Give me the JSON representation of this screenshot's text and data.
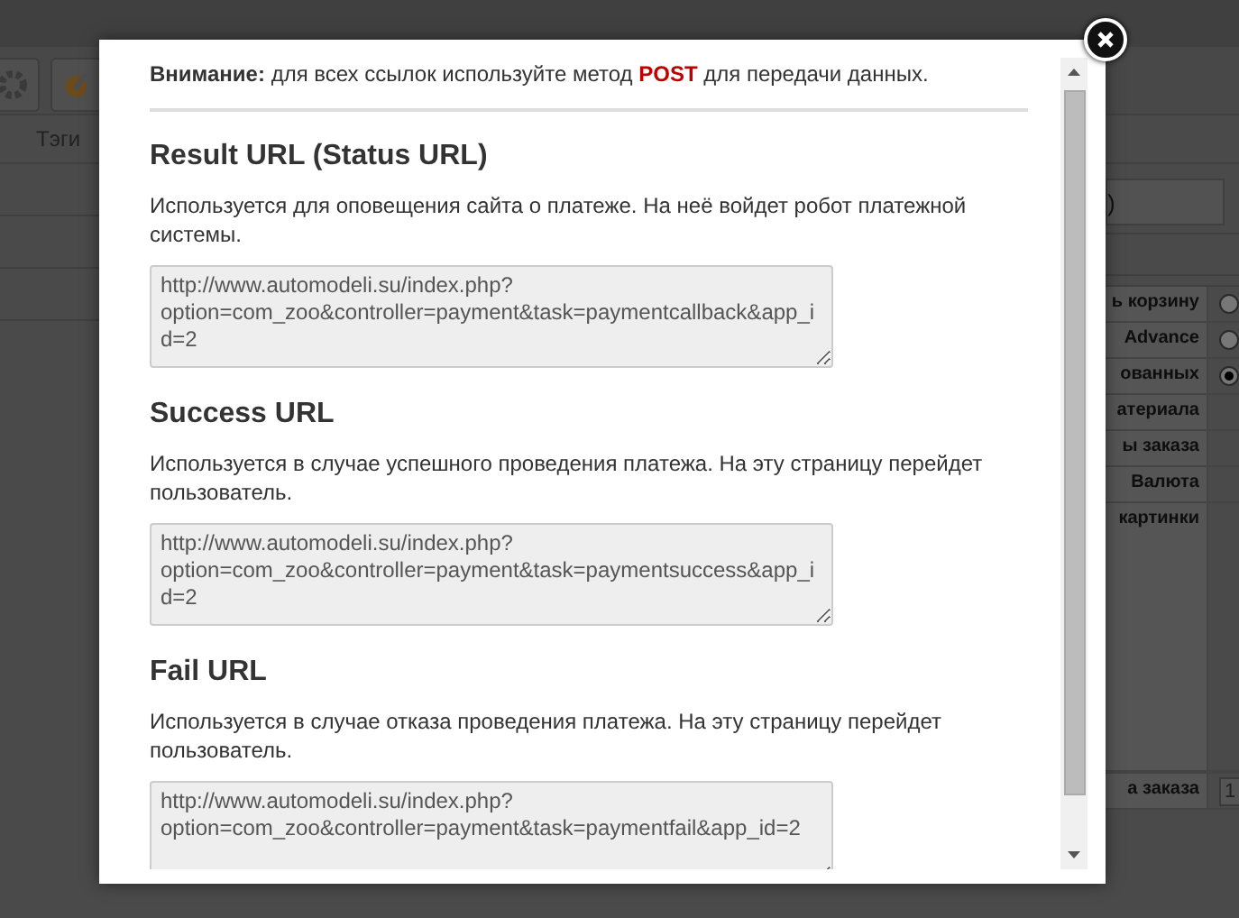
{
  "background": {
    "tab": "Тэги",
    "panel_heading": ")",
    "settings": [
      {
        "label": "ь корзину",
        "kind": "radio",
        "selected": false
      },
      {
        "label": "Advance",
        "kind": "radio",
        "selected": false
      },
      {
        "label": "ованных",
        "kind": "radio",
        "selected": true
      },
      {
        "label": "атериала",
        "kind": "plain"
      },
      {
        "label": "ы заказа",
        "kind": "plain"
      },
      {
        "label": "Валюта",
        "kind": "plain"
      },
      {
        "label": "картинки",
        "kind": "plain"
      },
      {
        "label": "а заказа",
        "kind": "input",
        "value": "1"
      }
    ]
  },
  "dialog": {
    "notice": "**Внимание:** для всех ссылок используйте метод **POST** для передачи данных.",
    "sections": [
      {
        "title": "Result URL (Status URL)",
        "description": "Используется для оповещения сайта о платеже. На неё войдет робот платежной системы.",
        "url": "http://www.automodeli.su/index.php?option=com_zoo&controller=payment&task=paymentcallback&app_id=2"
      },
      {
        "title": "Success URL",
        "description": "Используется в случае успешного проведения платежа. На эту страницу перейдет пользователь.",
        "url": "http://www.automodeli.su/index.php?option=com_zoo&controller=payment&task=paymentsuccess&app_id=2"
      },
      {
        "title": "Fail URL",
        "description": "Используется в случае отказа проведения платежа. На эту страницу перейдет пользователь.",
        "url": "http://www.automodeli.su/index.php?option=com_zoo&controller=payment&task=paymentfail&app_id=2"
      }
    ]
  }
}
